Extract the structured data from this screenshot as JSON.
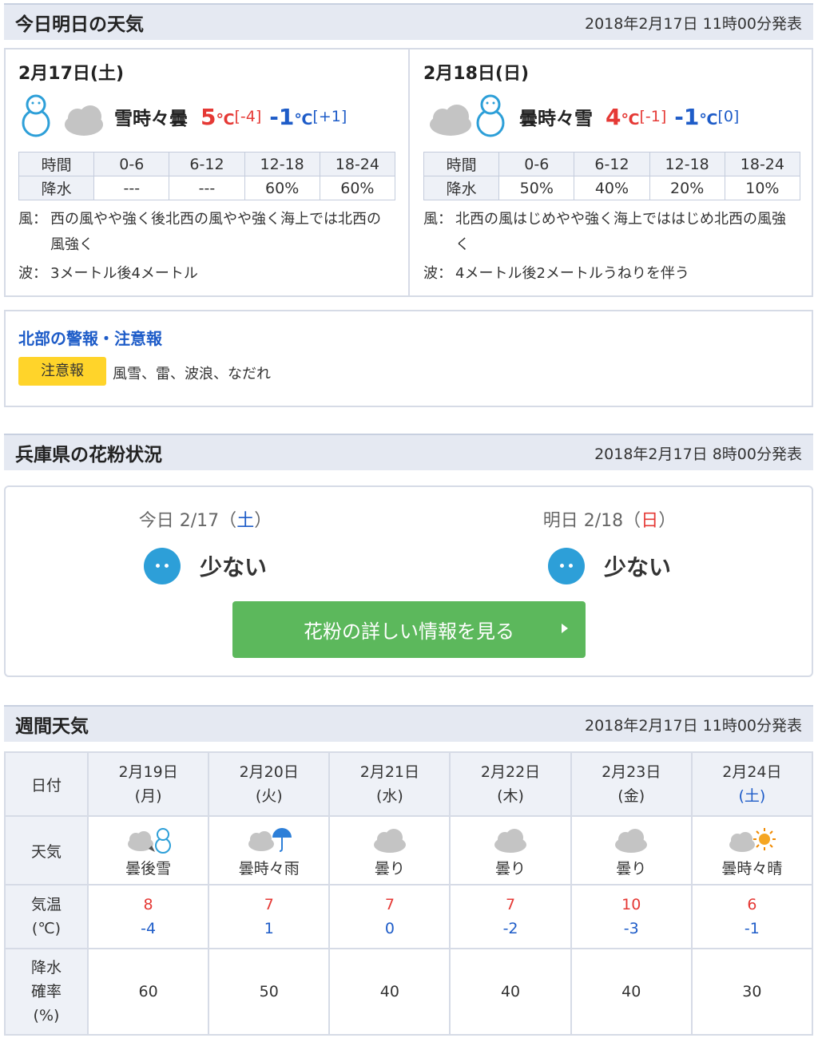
{
  "today_tomorrow": {
    "title": "今日明日の天気",
    "published": "2018年2月17日 11時00分発表",
    "days": [
      {
        "date": "2月17日(土)",
        "icons": [
          "snowman-icon",
          "cloud-icon"
        ],
        "weather": "雪時々曇",
        "high": "5",
        "high_unit": "℃",
        "high_diff": "[-4]",
        "low": "-1",
        "low_unit": "℃",
        "low_diff": "[+1]",
        "precip_header": [
          "時間",
          "0-6",
          "6-12",
          "12-18",
          "18-24"
        ],
        "precip_row": [
          "降水",
          "---",
          "---",
          "60%",
          "60%"
        ],
        "wind_label": "風：",
        "wind": "西の風やや強く後北西の風やや強く海上では北西の風強く",
        "wave_label": "波：",
        "wave": "3メートル後4メートル"
      },
      {
        "date": "2月18日(日)",
        "icons": [
          "cloud-icon",
          "snowman-icon"
        ],
        "weather": "曇時々雪",
        "high": "4",
        "high_unit": "℃",
        "high_diff": "[-1]",
        "low": "-1",
        "low_unit": "℃",
        "low_diff": "[0]",
        "precip_header": [
          "時間",
          "0-6",
          "6-12",
          "12-18",
          "18-24"
        ],
        "precip_row": [
          "降水",
          "50%",
          "40%",
          "20%",
          "10%"
        ],
        "wind_label": "風：",
        "wind": "北西の風はじめやや強く海上でははじめ北西の風強く",
        "wave_label": "波：",
        "wave": "4メートル後2メートルうねりを伴う"
      }
    ]
  },
  "warning": {
    "title": "北部の警報・注意報",
    "badge": "注意報",
    "text": "風雪、雷、波浪、なだれ"
  },
  "pollen": {
    "title": "兵庫県の花粉状況",
    "published": "2018年2月17日 8時00分発表",
    "days": [
      {
        "prefix": "今日 2/17（",
        "dow": "土",
        "suffix": "）",
        "level": "少ない"
      },
      {
        "prefix": "明日 2/18（",
        "dow": "日",
        "suffix": "）",
        "level": "少ない"
      }
    ],
    "button": "花粉の詳しい情報を見る"
  },
  "weekly": {
    "title": "週間天気",
    "published": "2018年2月17日 11時00分発表",
    "row_labels": {
      "date": "日付",
      "weather": "天気",
      "temp_1": "気温",
      "temp_2": "(℃)",
      "precip_1": "降水",
      "precip_2": "確率",
      "precip_3": "(%)"
    },
    "days": [
      {
        "date": "2月19日",
        "dow": "(月)",
        "icon": "cloud-then-snowman-icon",
        "weather": "曇後雪",
        "high": "8",
        "low": "-4",
        "precip": "60"
      },
      {
        "date": "2月20日",
        "dow": "(火)",
        "icon": "cloud-umbrella-icon",
        "weather": "曇時々雨",
        "high": "7",
        "low": "1",
        "precip": "50"
      },
      {
        "date": "2月21日",
        "dow": "(水)",
        "icon": "cloud-icon",
        "weather": "曇り",
        "high": "7",
        "low": "0",
        "precip": "40"
      },
      {
        "date": "2月22日",
        "dow": "(木)",
        "icon": "cloud-icon",
        "weather": "曇り",
        "high": "7",
        "low": "-2",
        "precip": "40"
      },
      {
        "date": "2月23日",
        "dow": "(金)",
        "icon": "cloud-icon",
        "weather": "曇り",
        "high": "10",
        "low": "-3",
        "precip": "40"
      },
      {
        "date": "2月24日",
        "dow": "(土)",
        "icon": "cloud-sun-icon",
        "weather": "曇時々晴",
        "high": "6",
        "low": "-1",
        "precip": "30"
      }
    ]
  }
}
